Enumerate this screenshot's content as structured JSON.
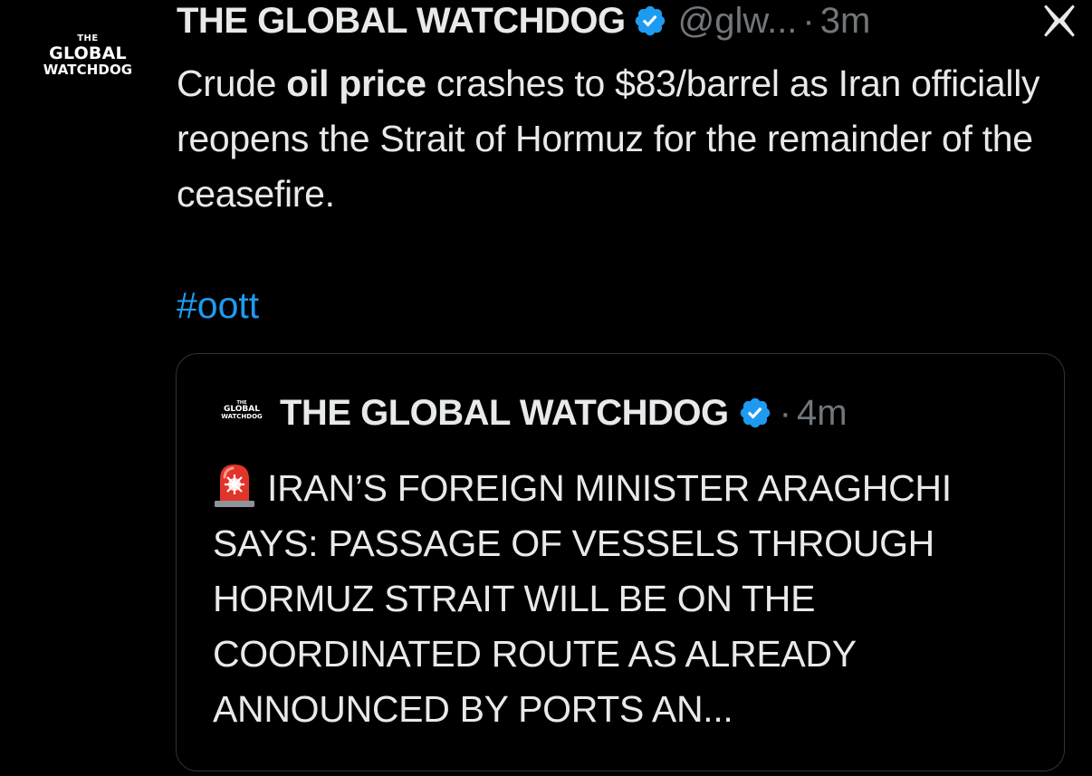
{
  "author": {
    "avatar_lines": [
      "THE",
      "GLOBAL",
      "WATCHDOG"
    ],
    "display_name": "THE GLOBAL WATCHDOG",
    "handle": "@glw...",
    "separator": "·",
    "time": "3m",
    "verified_icon": "verified-badge-icon",
    "platform_icon": "x-logo-icon"
  },
  "tweet": {
    "text_before": "Crude ",
    "text_bold": "oil price",
    "text_after": " crashes to $83/barrel as Iran officially reopens the Strait of Hormuz for the remainder of the ceasefire.",
    "hashtag": "#oott"
  },
  "quoted": {
    "avatar_lines": [
      "THE",
      "GLOBAL",
      "WATCHDOG"
    ],
    "display_name": "THE GLOBAL WATCHDOG",
    "separator": "·",
    "time": "4m",
    "verified_icon": "verified-badge-icon",
    "emoji_icon": "police-light-icon",
    "text": "IRAN’S FOREIGN MINISTER ARAGHCHI SAYS: PASSAGE OF VESSELS THROUGH HORMUZ STRAIT WILL BE ON THE COORDINATED ROUTE AS ALREADY ANNOUNCED BY PORTS AN..."
  },
  "colors": {
    "background": "#000000",
    "text": "#e7e9ea",
    "secondary": "#71767b",
    "link": "#1d9bf0",
    "verified": "#1d9bf0",
    "border": "#2f3336"
  }
}
